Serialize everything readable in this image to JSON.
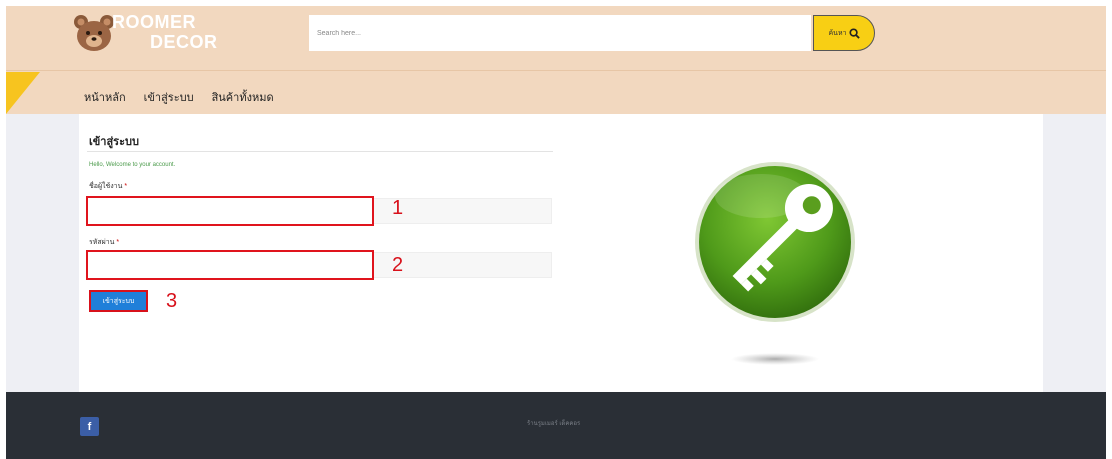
{
  "brand": {
    "line1": "ROOMER",
    "line2": "DECOR"
  },
  "search": {
    "placeholder": "Search here...",
    "button_label": "ค้นหา"
  },
  "nav": {
    "items": [
      "หน้าหลัก",
      "เข้าสู่ระบบ",
      "สินค้าทั้งหมด"
    ]
  },
  "login": {
    "title": "เข้าสู่ระบบ",
    "welcome": "Hello, Welcome to your account.",
    "username_label": "ชื่อผู้ใช้งาน",
    "password_label": "รหัสผ่าน",
    "required_mark": "*",
    "submit_label": "เข้าสู่ระบบ"
  },
  "annotations": [
    "1",
    "2",
    "3"
  ],
  "footer": {
    "social": "f",
    "copyright": "ร้านรูมเมอร์ เด็คคอร"
  },
  "colors": {
    "header": "#f2d8bf",
    "accent": "#f8cf14",
    "button": "#1f7fd9",
    "annotation": "#d8111b",
    "footer": "#2a2f36",
    "key_green": "#5a9e1e"
  }
}
